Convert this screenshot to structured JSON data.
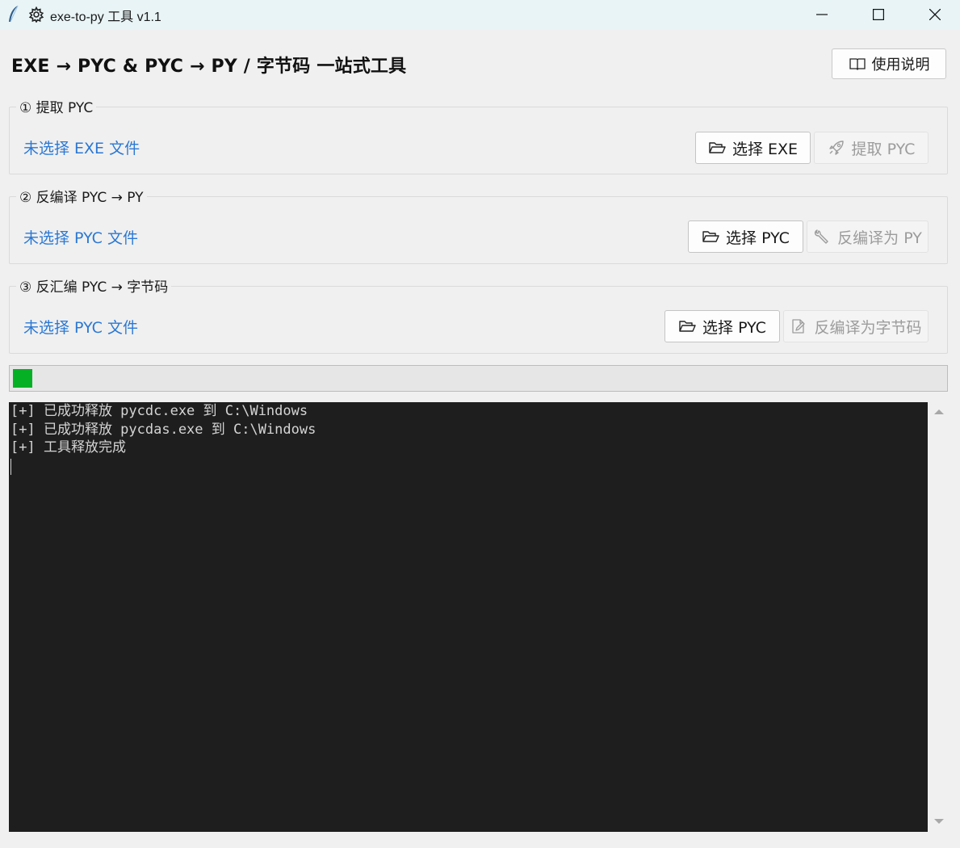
{
  "window": {
    "title": "exe-to-py 工具 v1.1"
  },
  "header": {
    "title": "EXE → PYC  &  PYC → PY / 字节码 一站式工具",
    "help_label": "使用说明"
  },
  "groups": [
    {
      "title": "① 提取 PYC",
      "status": "未选择 EXE 文件",
      "select_label": "选择 EXE",
      "action_label": "提取 PYC"
    },
    {
      "title": "② 反编译 PYC → PY",
      "status": "未选择 PYC 文件",
      "select_label": "选择 PYC",
      "action_label": "反编译为 PY"
    },
    {
      "title": "③ 反汇编 PYC → 字节码",
      "status": "未选择 PYC 文件",
      "select_label": "选择 PYC",
      "action_label": "反编译为字节码"
    }
  ],
  "progress": {
    "value_percent": 2.1,
    "color": "#06b025"
  },
  "console": {
    "lines": [
      "[+] 已成功释放 pycdc.exe 到 C:\\Windows",
      "[+] 已成功释放 pycdas.exe 到 C:\\Windows",
      "[+] 工具释放完成"
    ]
  },
  "colors": {
    "status_link": "#2b78d4",
    "console_bg": "#1e1e1e",
    "titlebar_bg": "#e8f4f6"
  },
  "icons": {
    "app": "feather-icon",
    "title": "gear-icon",
    "help": "book-icon",
    "select": "folder-open-icon",
    "extract": "rocket-icon",
    "decompile": "wrench-icon",
    "disassemble": "edit-document-icon"
  }
}
